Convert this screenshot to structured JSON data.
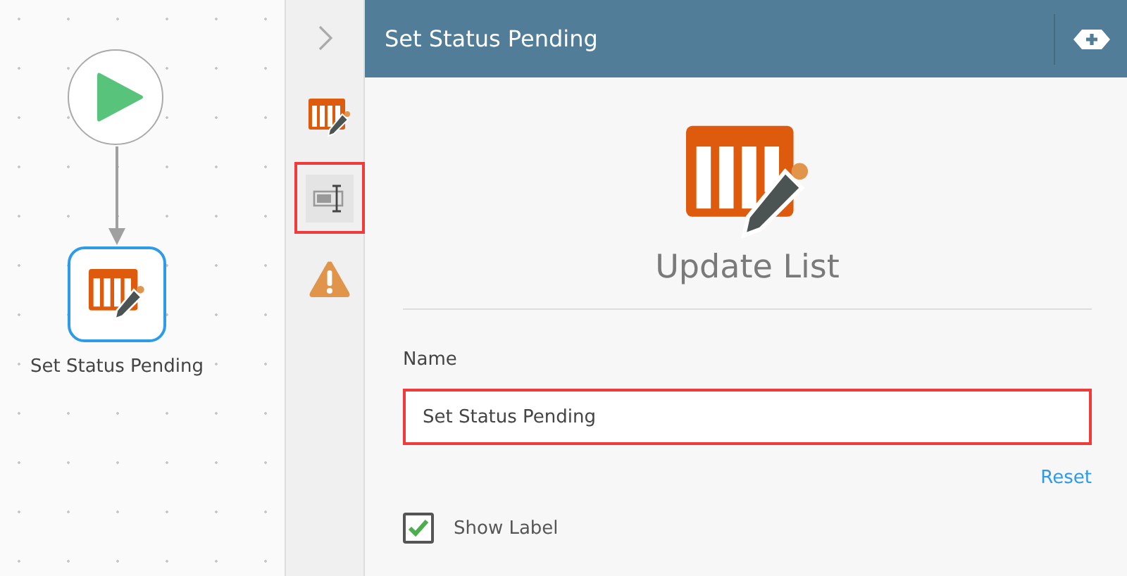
{
  "canvas": {
    "nodes": [
      {
        "kind": "start"
      },
      {
        "kind": "action",
        "selected": true,
        "label": "Set Status Pending"
      }
    ]
  },
  "rail": {
    "items": [
      {
        "kind": "action",
        "selected": false,
        "highlighted": false
      },
      {
        "kind": "properties",
        "selected": true,
        "highlighted": true
      },
      {
        "kind": "warning",
        "selected": false,
        "highlighted": false
      }
    ]
  },
  "panel": {
    "title": "Set Status Pending",
    "action_title": "Update List",
    "name_label": "Name",
    "name_value": "Set Status Pending",
    "name_highlighted": true,
    "reset": "Reset",
    "show_label": {
      "label": "Show Label",
      "checked": true
    }
  }
}
